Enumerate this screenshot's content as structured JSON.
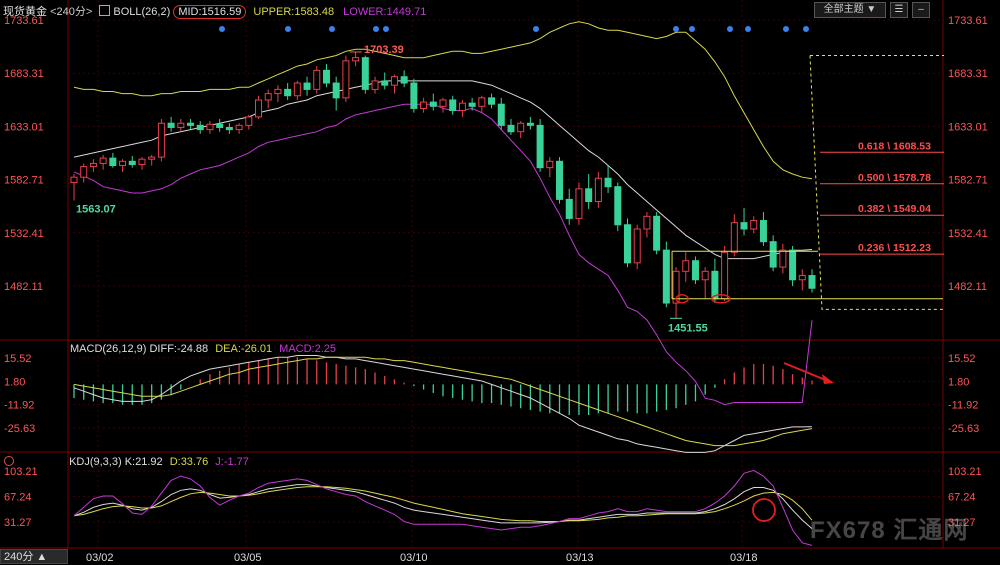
{
  "header": {
    "symbol": "现货黄金",
    "period": "<240分>",
    "boll_label": "BOLL(26,2)",
    "mid": "MID:1516.59",
    "upper": "UPPER:1583.48",
    "lower": "LOWER:1449.71",
    "theme_button": "全部主题 ▼",
    "tool1": "☰",
    "tool2": "–"
  },
  "macd_header": {
    "label": "MACD(26,12,9)",
    "diff": "DIFF:-24.88",
    "dea": "DEA:-26.01",
    "macd": "MACD:2.25"
  },
  "kdj_header": {
    "label": "KDJ(9,3,3)",
    "k": "K:21.92",
    "d": "D:33.76",
    "j": "J:-1.77"
  },
  "period_tab": "240分 ▲",
  "watermark": "FX678 汇通网",
  "colors": {
    "up": "#e8404a",
    "down": "#39d39a",
    "mid": "#d9d9d9",
    "upper": "#d8d84a",
    "lower": "#c23ad6",
    "fib": "#ff4d4d",
    "grid": "#3a0000",
    "axis_text": "#ff5555",
    "macd_dea": "#d8d84a",
    "kdj_j": "#c23ad6"
  },
  "chart_data": [
    {
      "type": "candlestick",
      "title": "现货黄金 240分",
      "yticks": [
        1482.11,
        1532.41,
        1582.71,
        1633.01,
        1683.31,
        1733.61
      ],
      "ylim": [
        1445,
        1745
      ],
      "xticks": [
        "03/02",
        "03/05",
        "03/10",
        "03/13",
        "03/18"
      ],
      "candles_ohlc": [
        [
          1580,
          1588,
          1563.07,
          1585
        ],
        [
          1585,
          1598,
          1580,
          1595
        ],
        [
          1595,
          1602,
          1590,
          1598
        ],
        [
          1598,
          1606,
          1592,
          1603
        ],
        [
          1603,
          1608,
          1594,
          1596
        ],
        [
          1596,
          1602,
          1590,
          1600
        ],
        [
          1600,
          1605,
          1594,
          1597
        ],
        [
          1597,
          1604,
          1592,
          1602
        ],
        [
          1602,
          1606,
          1596,
          1604
        ],
        [
          1604,
          1640,
          1600,
          1636
        ],
        [
          1636,
          1642,
          1628,
          1632
        ],
        [
          1632,
          1640,
          1628,
          1636
        ],
        [
          1636,
          1640,
          1630,
          1634
        ],
        [
          1634,
          1638,
          1626,
          1630
        ],
        [
          1630,
          1638,
          1626,
          1635
        ],
        [
          1635,
          1640,
          1628,
          1632
        ],
        [
          1632,
          1636,
          1626,
          1630
        ],
        [
          1630,
          1636,
          1626,
          1634
        ],
        [
          1634,
          1644,
          1630,
          1642
        ],
        [
          1642,
          1662,
          1640,
          1658
        ],
        [
          1658,
          1668,
          1650,
          1664
        ],
        [
          1664,
          1672,
          1656,
          1668
        ],
        [
          1668,
          1674,
          1658,
          1662
        ],
        [
          1662,
          1676,
          1658,
          1674
        ],
        [
          1674,
          1680,
          1662,
          1668
        ],
        [
          1668,
          1690,
          1664,
          1686
        ],
        [
          1686,
          1692,
          1670,
          1674
        ],
        [
          1674,
          1680,
          1648,
          1660
        ],
        [
          1660,
          1700,
          1656,
          1695
        ],
        [
          1695,
          1703.39,
          1690,
          1698
        ],
        [
          1698,
          1700,
          1664,
          1668
        ],
        [
          1668,
          1680,
          1664,
          1676
        ],
        [
          1676,
          1684,
          1668,
          1672
        ],
        [
          1672,
          1682,
          1664,
          1680
        ],
        [
          1680,
          1686,
          1670,
          1674
        ],
        [
          1674,
          1678,
          1646,
          1650
        ],
        [
          1650,
          1660,
          1646,
          1656
        ],
        [
          1656,
          1664,
          1648,
          1652
        ],
        [
          1652,
          1660,
          1646,
          1658
        ],
        [
          1658,
          1662,
          1644,
          1648
        ],
        [
          1648,
          1658,
          1642,
          1655
        ],
        [
          1655,
          1660,
          1648,
          1652
        ],
        [
          1652,
          1662,
          1646,
          1660
        ],
        [
          1660,
          1664,
          1650,
          1654
        ],
        [
          1654,
          1660,
          1630,
          1634
        ],
        [
          1634,
          1640,
          1625,
          1628
        ],
        [
          1628,
          1638,
          1622,
          1636
        ],
        [
          1636,
          1642,
          1630,
          1634
        ],
        [
          1634,
          1640,
          1590,
          1594
        ],
        [
          1594,
          1604,
          1585,
          1600
        ],
        [
          1600,
          1604,
          1560,
          1564
        ],
        [
          1564,
          1574,
          1540,
          1546
        ],
        [
          1546,
          1580,
          1540,
          1574
        ],
        [
          1574,
          1588,
          1555,
          1562
        ],
        [
          1562,
          1590,
          1556,
          1584
        ],
        [
          1584,
          1596,
          1570,
          1576
        ],
        [
          1576,
          1580,
          1534,
          1540
        ],
        [
          1540,
          1546,
          1500,
          1504
        ],
        [
          1504,
          1540,
          1498,
          1536
        ],
        [
          1536,
          1552,
          1528,
          1548
        ],
        [
          1548,
          1552,
          1512,
          1516
        ],
        [
          1516,
          1524,
          1462,
          1466
        ],
        [
          1466,
          1500,
          1451.55,
          1496
        ],
        [
          1496,
          1514,
          1486,
          1506
        ],
        [
          1506,
          1510,
          1484,
          1488
        ],
        [
          1488,
          1500,
          1470,
          1496
        ],
        [
          1496,
          1508,
          1466,
          1470
        ],
        [
          1470,
          1520,
          1468,
          1514
        ],
        [
          1514,
          1550,
          1510,
          1542
        ],
        [
          1542,
          1556,
          1530,
          1536
        ],
        [
          1536,
          1548,
          1532,
          1544
        ],
        [
          1544,
          1552,
          1520,
          1524
        ],
        [
          1524,
          1530,
          1496,
          1500
        ],
        [
          1500,
          1522,
          1494,
          1516
        ],
        [
          1516,
          1520,
          1482,
          1488
        ],
        [
          1488,
          1498,
          1478,
          1492
        ],
        [
          1492,
          1498,
          1476,
          1480
        ]
      ],
      "boll_mid": [
        1604,
        1606,
        1608,
        1610,
        1612,
        1614,
        1616,
        1618,
        1620,
        1624,
        1626,
        1628,
        1630,
        1632,
        1634,
        1636,
        1638,
        1640,
        1642,
        1646,
        1648,
        1650,
        1654,
        1656,
        1658,
        1662,
        1664,
        1666,
        1668,
        1670,
        1672,
        1674,
        1676,
        1676,
        1676,
        1676,
        1676,
        1676,
        1676,
        1676,
        1676,
        1676,
        1674,
        1672,
        1668,
        1664,
        1660,
        1656,
        1650,
        1642,
        1634,
        1626,
        1618,
        1610,
        1604,
        1596,
        1588,
        1578,
        1570,
        1562,
        1554,
        1546,
        1538,
        1530,
        1524,
        1518,
        1512,
        1508,
        1508,
        1508,
        1508,
        1510,
        1512,
        1514,
        1516,
        1516,
        1516.59
      ],
      "boll_upper": [
        1670,
        1668,
        1668,
        1666,
        1666,
        1664,
        1664,
        1662,
        1662,
        1664,
        1664,
        1666,
        1666,
        1666,
        1668,
        1668,
        1668,
        1670,
        1670,
        1674,
        1678,
        1682,
        1686,
        1690,
        1692,
        1696,
        1698,
        1700,
        1704,
        1706,
        1706,
        1704,
        1702,
        1700,
        1698,
        1698,
        1698,
        1700,
        1702,
        1704,
        1704,
        1702,
        1702,
        1704,
        1706,
        1708,
        1710,
        1712,
        1716,
        1722,
        1726,
        1730,
        1732,
        1730,
        1726,
        1724,
        1724,
        1722,
        1720,
        1718,
        1716,
        1718,
        1722,
        1722,
        1714,
        1706,
        1694,
        1680,
        1662,
        1646,
        1630,
        1614,
        1600,
        1592,
        1588,
        1585,
        1583.48
      ],
      "boll_lower": [
        1590,
        1586,
        1582,
        1576,
        1574,
        1572,
        1570,
        1570,
        1572,
        1574,
        1578,
        1584,
        1588,
        1592,
        1594,
        1596,
        1600,
        1604,
        1608,
        1614,
        1618,
        1620,
        1622,
        1624,
        1626,
        1628,
        1632,
        1634,
        1640,
        1644,
        1646,
        1648,
        1650,
        1652,
        1654,
        1654,
        1654,
        1654,
        1650,
        1648,
        1648,
        1650,
        1646,
        1640,
        1630,
        1620,
        1610,
        1600,
        1584,
        1566,
        1550,
        1530,
        1512,
        1504,
        1498,
        1492,
        1478,
        1462,
        1458,
        1450,
        1436,
        1420,
        1410,
        1402,
        1392,
        1376,
        1374,
        1370,
        1372,
        1372,
        1372,
        1372,
        1372,
        1372,
        1372,
        1372,
        1449.71
      ],
      "annotations": [
        {
          "text": "1703.39",
          "value": 1703.39
        },
        {
          "text": "1563.07",
          "value": 1563.07
        },
        {
          "text": "1451.55",
          "value": 1451.55
        }
      ],
      "fibonacci": [
        {
          "text": "0.618 \\ 1608.53",
          "value": 1608.53
        },
        {
          "text": "0.500 \\ 1578.78",
          "value": 1578.78
        },
        {
          "text": "0.382 \\ 1549.04",
          "value": 1549.04
        },
        {
          "text": "0.236 \\ 1512.23",
          "value": 1512.23
        }
      ],
      "channel": {
        "top": 1515,
        "bottom": 1470
      },
      "projection_box": {
        "top": 1700,
        "bottom": 1460
      }
    },
    {
      "type": "bar",
      "title": "MACD(26,12,9)",
      "yticks": [
        15.52,
        1.8,
        -11.92,
        -25.63
      ],
      "ylim": [
        -35,
        22
      ],
      "macd_hist": [
        -8,
        -9,
        -10,
        -11,
        -11,
        -12,
        -12,
        -12,
        -11,
        -9,
        -6,
        -3,
        0,
        3,
        6,
        8,
        10,
        12,
        13,
        14,
        15,
        16,
        16,
        16,
        15,
        14,
        13,
        12,
        11,
        10,
        9,
        7,
        5,
        3,
        1,
        -1,
        -3,
        -5,
        -7,
        -8,
        -9,
        -10,
        -11,
        -11,
        -12,
        -13,
        -14,
        -15,
        -16,
        -17,
        -17,
        -18,
        -18,
        -18,
        -17,
        -17,
        -16,
        -16,
        -17,
        -17,
        -16,
        -15,
        -14,
        -12,
        -10,
        -6,
        -2,
        3,
        7,
        10,
        12,
        12,
        11,
        9,
        6,
        4,
        2.25
      ],
      "diff_line": [
        -2,
        -4,
        -6,
        -8,
        -9,
        -10,
        -10,
        -10,
        -9,
        -6,
        -2,
        2,
        5,
        7,
        9,
        10,
        11,
        12,
        13,
        14,
        15,
        16,
        16,
        17,
        17,
        17,
        16,
        16,
        15,
        15,
        14,
        13,
        12,
        11,
        10,
        9,
        8,
        7,
        6,
        5,
        4,
        3,
        2,
        0,
        -2,
        -4,
        -6,
        -8,
        -11,
        -14,
        -17,
        -20,
        -24,
        -26,
        -28,
        -30,
        -32,
        -33,
        -35,
        -36,
        -37,
        -38,
        -39,
        -40,
        -40,
        -40,
        -39,
        -36,
        -33,
        -30,
        -29,
        -28,
        -27,
        -26,
        -25,
        -25,
        -24.88
      ],
      "dea_line": [
        0,
        -1,
        -2,
        -3,
        -4,
        -5,
        -6,
        -7,
        -7,
        -7,
        -6,
        -4,
        -2,
        0,
        2,
        4,
        6,
        7,
        9,
        10,
        11,
        12,
        13,
        14,
        15,
        15,
        16,
        16,
        16,
        16,
        16,
        15,
        15,
        14,
        14,
        13,
        12,
        11,
        10,
        9,
        8,
        7,
        6,
        5,
        4,
        3,
        1,
        -1,
        -3,
        -5,
        -7,
        -9,
        -11,
        -13,
        -15,
        -17,
        -19,
        -21,
        -23,
        -25,
        -27,
        -29,
        -31,
        -33,
        -34,
        -35,
        -36,
        -36,
        -36,
        -35,
        -34,
        -33,
        -31,
        -29,
        -28,
        -27,
        -26.01
      ]
    },
    {
      "type": "line",
      "title": "KDJ(9,3,3)",
      "yticks": [
        103.21,
        67.24,
        31.27
      ],
      "ylim": [
        -10,
        110
      ],
      "series": [
        {
          "name": "K",
          "values": [
            40,
            45,
            52,
            56,
            58,
            55,
            50,
            48,
            52,
            60,
            70,
            76,
            78,
            76,
            70,
            65,
            66,
            68,
            70,
            74,
            78,
            80,
            82,
            84,
            84,
            82,
            80,
            78,
            76,
            74,
            70,
            66,
            62,
            58,
            52,
            48,
            46,
            44,
            42,
            40,
            38,
            36,
            34,
            32,
            30,
            30,
            30,
            30,
            30,
            31,
            32,
            34,
            34,
            36,
            38,
            40,
            42,
            42,
            42,
            44,
            44,
            44,
            44,
            44,
            44,
            46,
            50,
            56,
            64,
            74,
            80,
            80,
            76,
            64,
            48,
            34,
            21.92
          ]
        },
        {
          "name": "D",
          "values": [
            40,
            42,
            46,
            50,
            53,
            54,
            53,
            51,
            51,
            54,
            60,
            66,
            71,
            73,
            72,
            70,
            68,
            68,
            69,
            71,
            74,
            76,
            78,
            80,
            81,
            81,
            81,
            80,
            79,
            77,
            75,
            72,
            69,
            66,
            62,
            58,
            55,
            52,
            49,
            46,
            43,
            41,
            39,
            37,
            35,
            34,
            33,
            33,
            32,
            32,
            32,
            33,
            33,
            34,
            35,
            37,
            38,
            40,
            40,
            41,
            42,
            43,
            43,
            43,
            43,
            44,
            46,
            50,
            55,
            61,
            68,
            72,
            73,
            70,
            62,
            50,
            33.76
          ]
        },
        {
          "name": "J",
          "values": [
            40,
            52,
            64,
            68,
            68,
            57,
            44,
            42,
            54,
            72,
            90,
            96,
            92,
            82,
            66,
            55,
            62,
            68,
            72,
            80,
            86,
            88,
            90,
            92,
            90,
            84,
            78,
            74,
            70,
            68,
            60,
            54,
            48,
            42,
            32,
            28,
            28,
            28,
            28,
            28,
            28,
            26,
            24,
            22,
            20,
            22,
            24,
            24,
            26,
            29,
            32,
            36,
            36,
            40,
            44,
            46,
            50,
            46,
            46,
            50,
            48,
            46,
            46,
            46,
            46,
            50,
            58,
            68,
            82,
            100,
            104,
            96,
            82,
            52,
            20,
            2,
            -1.77
          ]
        }
      ]
    }
  ]
}
